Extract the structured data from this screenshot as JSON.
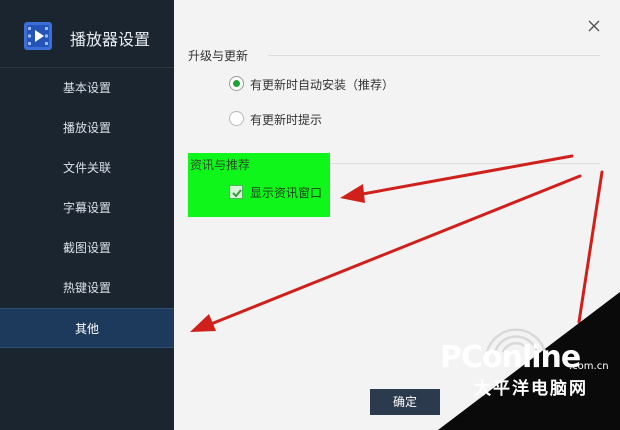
{
  "app": {
    "title": "播放器设置"
  },
  "sidebar": {
    "items": [
      {
        "label": "基本设置"
      },
      {
        "label": "播放设置"
      },
      {
        "label": "文件关联"
      },
      {
        "label": "字幕设置"
      },
      {
        "label": "截图设置"
      },
      {
        "label": "热键设置"
      },
      {
        "label": "其他",
        "active": true
      }
    ]
  },
  "panel": {
    "update_section": {
      "title": "升级与更新",
      "options": [
        {
          "label": "有更新时自动安装（推荐）",
          "checked": true
        },
        {
          "label": "有更新时提示",
          "checked": false
        }
      ]
    },
    "news_section": {
      "title": "资讯与推荐",
      "checkbox_label": "显示资讯窗口",
      "checked": true
    },
    "ok_label": "确定"
  },
  "watermark": {
    "logo": "PConline",
    "domain": ".com.cn",
    "name": "太平洋电脑网"
  },
  "colors": {
    "sidebar_bg": "#1b2530",
    "active_item_bg": "#1d3a5c",
    "radio_accent": "#22a33a",
    "highlight": "#0ff71a",
    "arrow": "#d0201c"
  }
}
